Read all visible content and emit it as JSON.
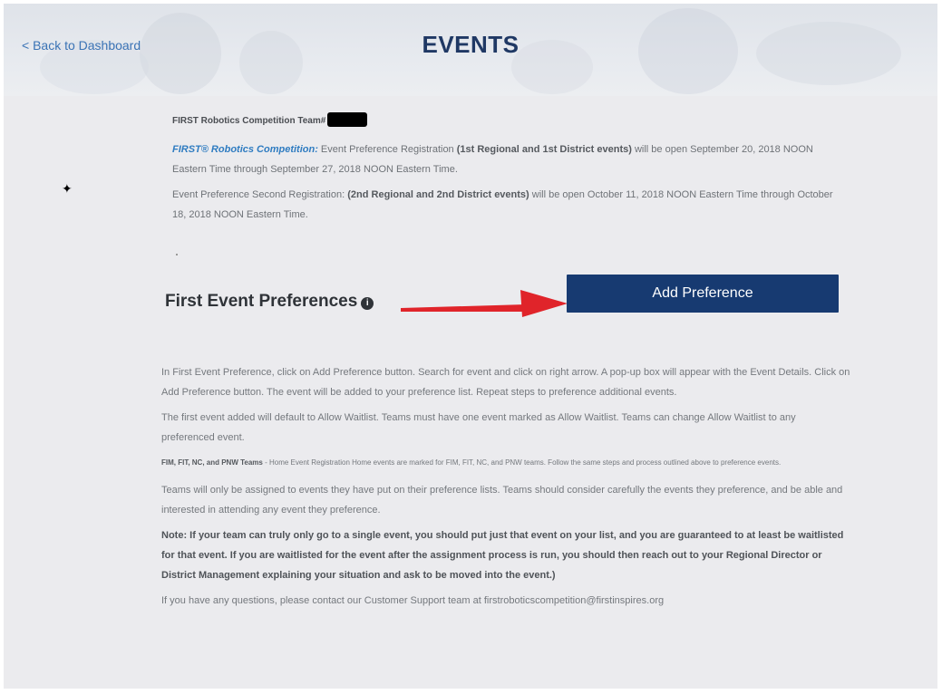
{
  "header": {
    "back_link": "< Back to Dashboard",
    "title": "EVENTS"
  },
  "intro": {
    "team_label": "FIRST Robotics Competition Team#",
    "para1": {
      "link": "FIRST® Robotics Competition:",
      "text_a": " Event Preference Registration ",
      "bold": "(1st Regional and 1st District events)",
      "text_b": " will be open September 20, 2018 NOON Eastern Time through September 27, 2018 NOON Eastern Time."
    },
    "para2": {
      "text_a": "Event Preference Second Registration: ",
      "bold": "(2nd Regional and 2nd District events)",
      "text_b": " will be open October 11, 2018 NOON Eastern Time through October 18, 2018 NOON Eastern Time."
    }
  },
  "preferences": {
    "title": "First Event Preferences",
    "info_icon": "i",
    "add_button": "Add Preference",
    "arrow_color": "#e0242a",
    "button_color": "#173a71"
  },
  "instructions": {
    "p1": "In First Event Preference, click on Add Preference button. Search for event and click on right arrow. A pop-up box will appear with the Event Details. Click on Add Preference button. The event will be added to your preference list. Repeat steps to preference additional events.",
    "p2": "The first event added will default to Allow Waitlist. Teams must have one event marked as Allow Waitlist. Teams can change Allow Waitlist to any preferenced event.",
    "p3_bold": "FIM, FIT, NC, and PNW Teams",
    "p3_text": " - Home Event Registration Home events are marked for FIM, FIT, NC, and PNW teams. Follow the same steps and process outlined above to preference events.",
    "p4": "Teams will only be assigned to events they have put on their preference lists. Teams should consider carefully the events they preference, and be able and interested in attending any event they preference.",
    "note": "Note: If your team can truly only go to a single event, you should put just that event on your list, and you are guaranteed to at least be waitlisted for that event. If you are waitlisted for the event after the assignment process is run, you should then reach out to your Regional Director or District Management explaining your situation and ask to be moved into the event.)",
    "contact": "If you have any questions, please contact our Customer Support team at firstroboticscompetition@firstinspires.org"
  }
}
